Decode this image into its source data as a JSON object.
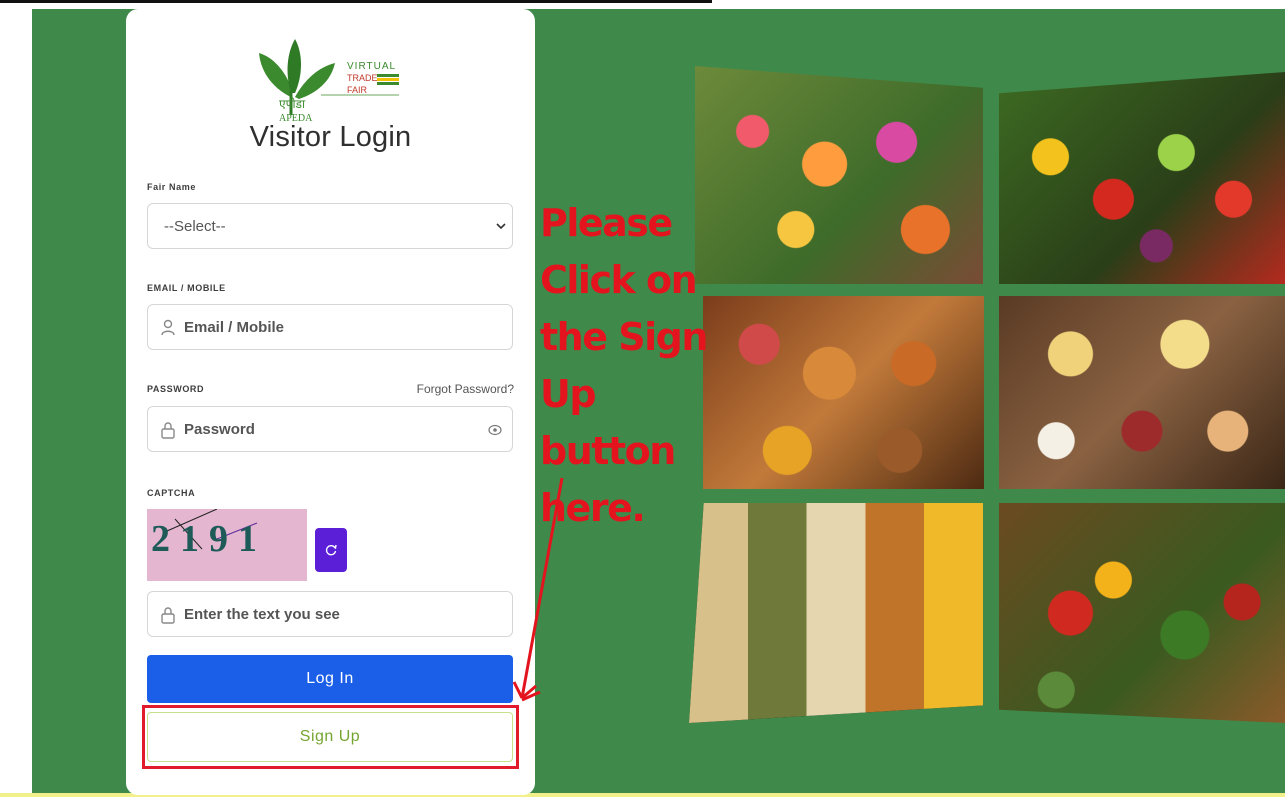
{
  "logo": {
    "brand_line1": "VIRTUAL",
    "brand_line2": "TRADE",
    "brand_line3": "FAIR",
    "hindi": "एपीडा",
    "apeda": "APEDA"
  },
  "login": {
    "title": "Visitor Login",
    "fair_label": "Fair Name",
    "fair_selected": "--Select--",
    "email_label": "EMAIL / MOBILE",
    "email_placeholder": "Email / Mobile",
    "password_label": "PASSWORD",
    "forgot_link": "Forgot Password?",
    "password_placeholder": "Password",
    "captcha_label": "CAPTCHA",
    "captcha_text": "2191",
    "captcha_placeholder": "Enter the text you see",
    "login_button": "Log In",
    "signup_button": "Sign Up"
  },
  "annotation": {
    "line1": "Please",
    "line2": "Click on",
    "line3": "the Sign",
    "line4": "Up button",
    "line5": "here."
  },
  "gallery": [
    {
      "subject": "flowers"
    },
    {
      "subject": "vegetables"
    },
    {
      "subject": "snacks"
    },
    {
      "subject": "dairy-and-meat"
    },
    {
      "subject": "grains-and-seeds"
    },
    {
      "subject": "vegetable-basket"
    }
  ],
  "colors": {
    "stage_green": "#3f8a4b",
    "login_blue": "#1b5ee8",
    "signup_green_text": "#75a531",
    "refresh_purple": "#5b1fd8",
    "annotation_red": "#e3141e"
  }
}
